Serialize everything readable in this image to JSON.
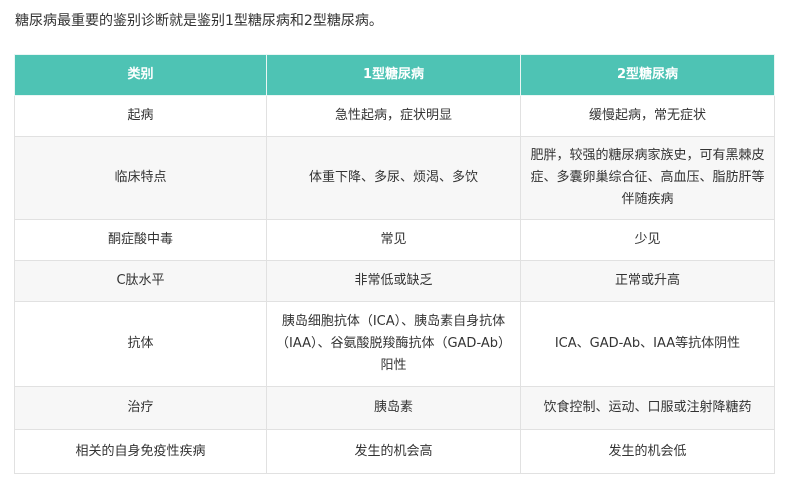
{
  "intro": "糖尿病最重要的鉴别诊断就是鉴别1型糖尿病和2型糖尿病。",
  "table": {
    "headers": [
      "类别",
      "1型糖尿病",
      "2型糖尿病"
    ],
    "rows": [
      [
        "起病",
        "急性起病，症状明显",
        "缓慢起病，常无症状"
      ],
      [
        "临床特点",
        "体重下降、多尿、烦渴、多饮",
        "肥胖，较强的糖尿病家族史，可有黑棘皮症、多囊卵巢综合征、高血压、脂肪肝等伴随疾病"
      ],
      [
        "酮症酸中毒",
        "常见",
        "少见"
      ],
      [
        "C肽水平",
        "非常低或缺乏",
        "正常或升高"
      ],
      [
        "抗体",
        "胰岛细胞抗体（ICA）、胰岛素自身抗体（IAA）、谷氨酸脱羧酶抗体（GAD-Ab）阳性",
        "ICA、GAD-Ab、IAA等抗体阴性"
      ],
      [
        "治疗",
        "胰岛素",
        "饮食控制、运动、口服或注射降糖药"
      ],
      [
        "相关的自身免疫性疾病",
        "发生的机会高",
        "发生的机会低"
      ]
    ]
  }
}
